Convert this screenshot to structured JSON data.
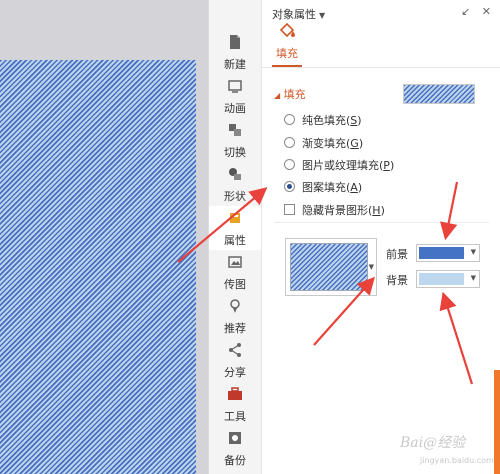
{
  "sidebar": {
    "items": [
      {
        "label": "新建",
        "icon": "new-file-icon"
      },
      {
        "label": "动画",
        "icon": "animation-icon"
      },
      {
        "label": "切换",
        "icon": "transition-icon"
      },
      {
        "label": "形状",
        "icon": "shapes-icon"
      },
      {
        "label": "属性",
        "icon": "properties-icon"
      },
      {
        "label": "传图",
        "icon": "upload-image-icon"
      },
      {
        "label": "推荐",
        "icon": "recommend-icon"
      },
      {
        "label": "分享",
        "icon": "share-icon"
      },
      {
        "label": "工具",
        "icon": "toolbox-icon"
      },
      {
        "label": "备份",
        "icon": "backup-icon"
      }
    ]
  },
  "panel": {
    "title": "对象属性",
    "tab_fill": "填充",
    "section": "填充",
    "options": [
      {
        "label": "纯色填充",
        "key": "S"
      },
      {
        "label": "渐变填充",
        "key": "G"
      },
      {
        "label": "图片或纹理填充",
        "key": "P"
      },
      {
        "label": "图案填充",
        "key": "A"
      }
    ],
    "hide_bg": {
      "label": "隐藏背景图形",
      "key": "H"
    },
    "foreground_label": "前景",
    "background_label": "背景"
  },
  "colors": {
    "foreground": "#4472c4",
    "background": "#bdd7ee",
    "accent": "#d0592a",
    "arrow": "#e8423a"
  },
  "watermark": {
    "text": "Bai@经验",
    "sub": "jingyan.baidu.com"
  }
}
